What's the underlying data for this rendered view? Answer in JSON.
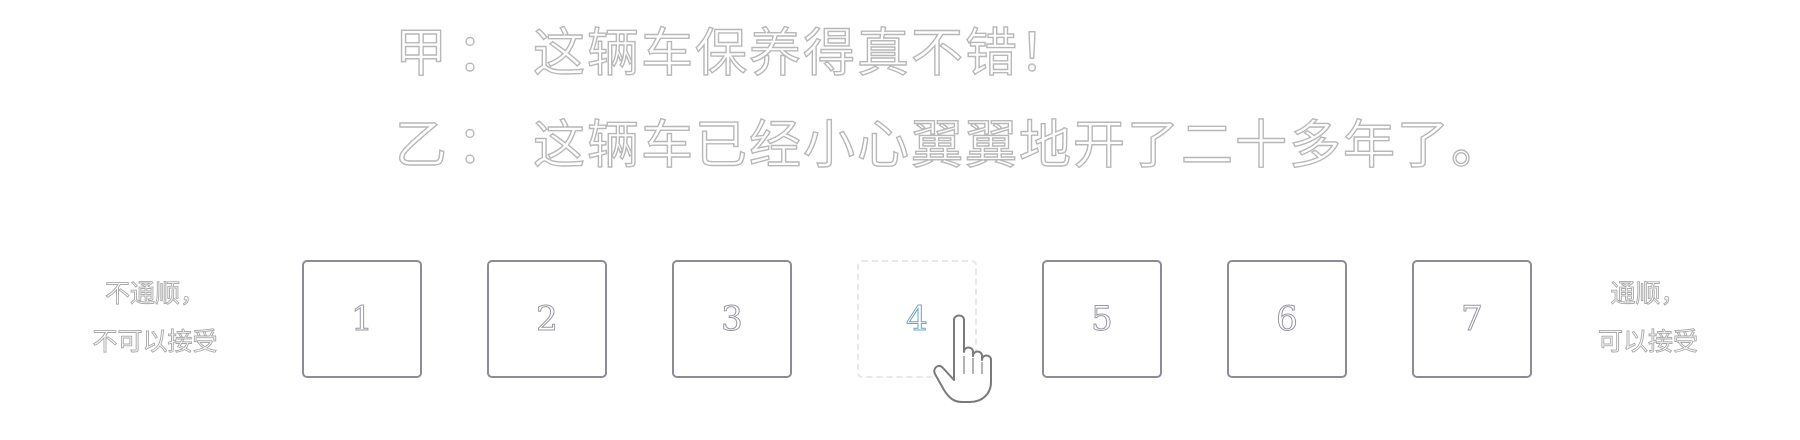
{
  "dialogue": [
    {
      "speaker": "甲",
      "colon": "：",
      "text": "这辆车保养得真不错！"
    },
    {
      "speaker": "乙",
      "colon": "：",
      "text": "这辆车已经小心翼翼地开了二十多年了。"
    }
  ],
  "scale": {
    "left_label": [
      "不通顺，",
      "不可以接受"
    ],
    "right_label": [
      "通顺，",
      "可以接受"
    ],
    "options": [
      "1",
      "2",
      "3",
      "4",
      "5",
      "6",
      "7"
    ],
    "hovered_option": "4"
  },
  "colors": {
    "text_outline": "#b8b8b8",
    "box_border": "#8f8a98",
    "hover_number": "#6aa6c8"
  },
  "cursor_icon": "hand-pointer-icon"
}
